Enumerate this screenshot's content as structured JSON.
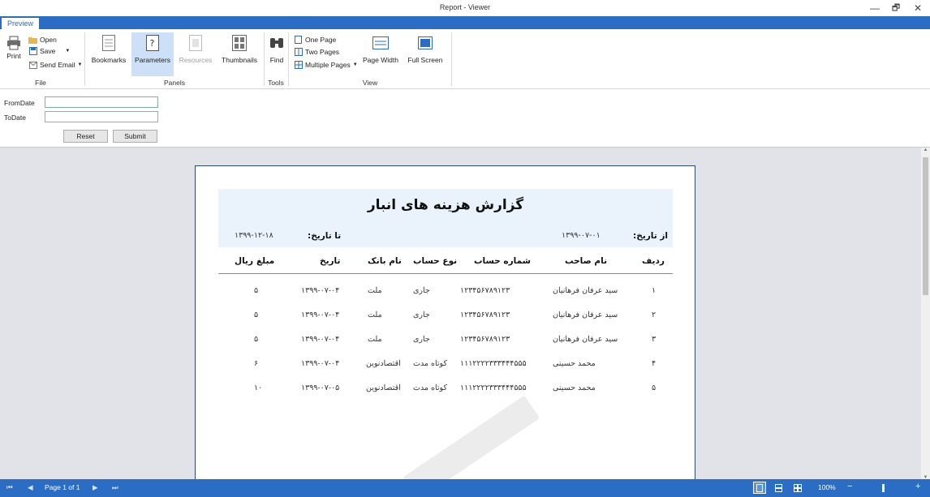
{
  "window": {
    "title": "Report - Viewer",
    "controls": [
      "—",
      "🗗",
      "✕"
    ]
  },
  "ribbon": {
    "tab": "Preview",
    "groups": {
      "file": {
        "label": "File",
        "print": "Print",
        "open": "Open",
        "save": "Save",
        "send_email": "Send Email"
      },
      "panels": {
        "label": "Panels",
        "bookmarks": "Bookmarks",
        "parameters": "Parameters",
        "resources": "Resources",
        "thumbnails": "Thumbnails"
      },
      "tools": {
        "label": "Tools",
        "find": "Find"
      },
      "view": {
        "label": "View",
        "one_page": "One Page",
        "two_pages": "Two Pages",
        "multiple_pages": "Multiple Pages",
        "page_width": "Page Width",
        "full_screen": "Full Screen"
      }
    }
  },
  "parameters": {
    "from_label": "FromDate",
    "to_label": "ToDate",
    "from_value": "",
    "to_value": "",
    "reset": "Reset",
    "submit": "Submit"
  },
  "report": {
    "title": "گزارش هزینه های انبار",
    "from_label": "از تاریخ:",
    "from_value": "۱۳۹۹-۰۷-۰۱",
    "to_label": "تا تاریخ:",
    "to_value": "۱۳۹۹-۱۲-۱۸",
    "columns": {
      "row": "ردیف",
      "owner": "نام صاحب",
      "account_no": "شماره حساب",
      "account_type": "نوع حساب",
      "bank": "نام بانک",
      "date": "تاریخ",
      "amount": "مبلغ",
      "currency": "ریال"
    },
    "rows": [
      {
        "row": "۱",
        "owner": "سید عرفان فرهانیان",
        "account_no": "۱۲۳۴۵۶۷۸۹۱۲۳",
        "account_type": "جاری",
        "bank": "ملت",
        "date": "۱۳۹۹-۰۷-۰۴",
        "amount": "۵"
      },
      {
        "row": "۲",
        "owner": "سید عرفان فرهانیان",
        "account_no": "۱۲۳۴۵۶۷۸۹۱۲۳",
        "account_type": "جاری",
        "bank": "ملت",
        "date": "۱۳۹۹-۰۷-۰۴",
        "amount": "۵"
      },
      {
        "row": "۳",
        "owner": "سید عرفان فرهانیان",
        "account_no": "۱۲۳۴۵۶۷۸۹۱۲۳",
        "account_type": "جاری",
        "bank": "ملت",
        "date": "۱۳۹۹-۰۷-۰۴",
        "amount": "۵"
      },
      {
        "row": "۴",
        "owner": "محمد حسینی",
        "account_no": "۱۱۱۲۲۲۲۳۳۳۴۴۴۵۵۵",
        "account_type": "کوتاه مدت",
        "bank": "اقتصادنوین",
        "date": "۱۳۹۹-۰۷-۰۴",
        "amount": "۶"
      },
      {
        "row": "۵",
        "owner": "محمد حسینی",
        "account_no": "۱۱۱۲۲۲۲۳۳۳۴۴۴۵۵۵",
        "account_type": "کوتاه مدت",
        "bank": "اقتصادنوین",
        "date": "۱۳۹۹-۰۷-۰۵",
        "amount": "۱۰"
      }
    ]
  },
  "statusbar": {
    "page_info": "Page 1 of 1",
    "zoom": "100%",
    "minus": "−",
    "plus": "+"
  }
}
